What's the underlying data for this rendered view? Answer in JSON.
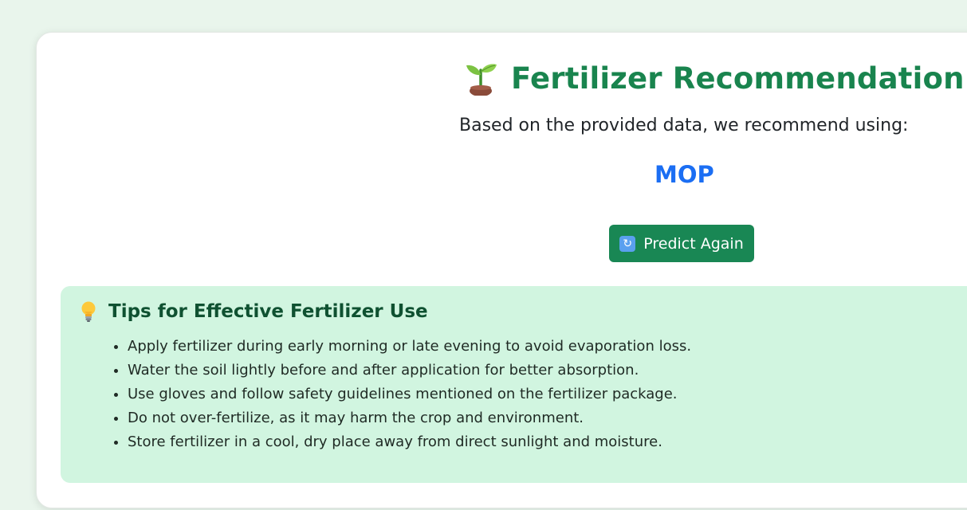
{
  "header": {
    "icon": "seedling-icon",
    "title": "Fertilizer Recommendation",
    "subtitle": "Based on the provided data, we recommend using:"
  },
  "result": {
    "fertilizer": "MOP"
  },
  "actions": {
    "predict_again_icon": "refresh-icon",
    "predict_again_label": "Predict Again"
  },
  "tips": {
    "icon": "lightbulb-icon",
    "title": "Tips for Effective Fertilizer Use",
    "items": [
      "Apply fertilizer during early morning or late evening to avoid evaporation loss.",
      "Water the soil lightly before and after application for better absorption.",
      "Use gloves and follow safety guidelines mentioned on the fertilizer package.",
      "Do not over-fertilize, as it may harm the crop and environment.",
      "Store fertilizer in a cool, dry place away from direct sunlight and moisture."
    ]
  },
  "colors": {
    "page_background": "#e9f5ec",
    "title": "#19844e",
    "result": "#1b6ef3",
    "button": "#198754",
    "tips_background": "#d1f5e0",
    "tips_title": "#0f5131"
  }
}
